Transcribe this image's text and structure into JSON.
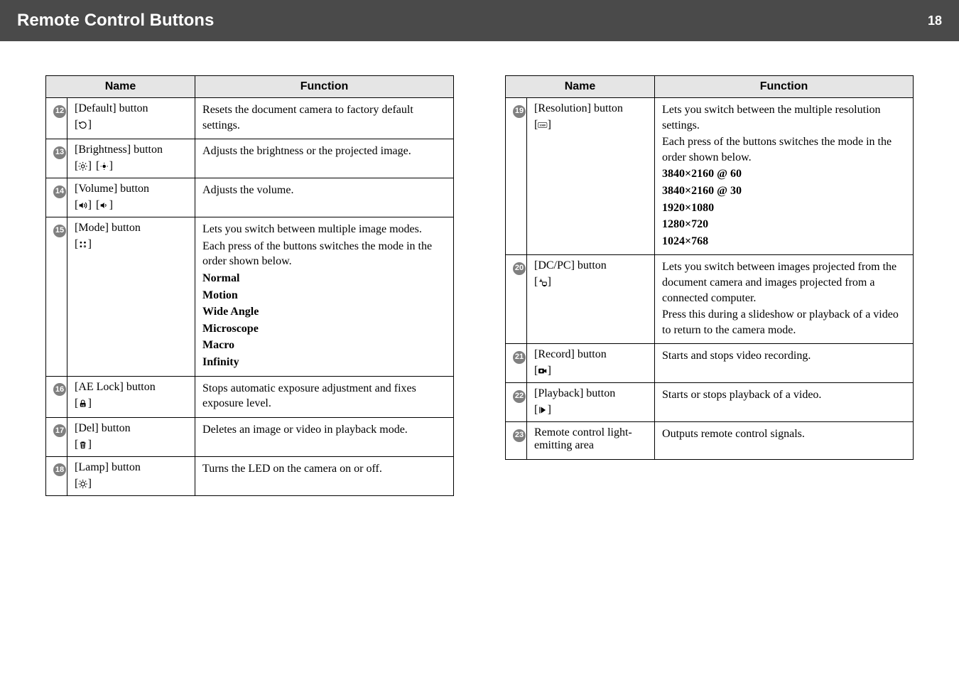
{
  "header": {
    "title": "Remote Control Buttons",
    "page": "18"
  },
  "columns": {
    "name_header": "Name",
    "function_header": "Function"
  },
  "left": [
    {
      "num": "12",
      "name": "[Default] button",
      "icon_names": [
        "default-icon"
      ],
      "func_lines": [
        {
          "t": "Resets the document camera to factory default settings."
        }
      ]
    },
    {
      "num": "13",
      "name": "[Brightness] button",
      "icon_names": [
        "brightness-up-icon",
        "brightness-down-icon"
      ],
      "func_lines": [
        {
          "t": "Adjusts the brightness or the projected image."
        }
      ]
    },
    {
      "num": "14",
      "name": "[Volume] button",
      "icon_names": [
        "volume-up-icon",
        "volume-down-icon"
      ],
      "func_lines": [
        {
          "t": "Adjusts the volume."
        }
      ]
    },
    {
      "num": "15",
      "name": "[Mode] button",
      "icon_names": [
        "mode-icon"
      ],
      "func_lines": [
        {
          "t": "Lets you switch between multiple image modes."
        },
        {
          "t": "Each press of the buttons switches the mode in the order shown below."
        },
        {
          "t": "Normal",
          "bold": true
        },
        {
          "t": "Motion",
          "bold": true
        },
        {
          "t": "Wide Angle",
          "bold": true
        },
        {
          "t": "Microscope",
          "bold": true
        },
        {
          "t": "Macro",
          "bold": true
        },
        {
          "t": "Infinity",
          "bold": true
        }
      ]
    },
    {
      "num": "16",
      "name": "[AE Lock] button",
      "icon_names": [
        "ae-lock-icon"
      ],
      "func_lines": [
        {
          "t": "Stops automatic exposure adjustment and fixes exposure level."
        }
      ]
    },
    {
      "num": "17",
      "name": "[Del] button",
      "icon_names": [
        "delete-icon"
      ],
      "func_lines": [
        {
          "t": "Deletes an image or video in playback mode."
        }
      ]
    },
    {
      "num": "18",
      "name": "[Lamp] button",
      "icon_names": [
        "lamp-icon"
      ],
      "func_lines": [
        {
          "t": "Turns the LED on the camera on or off."
        }
      ]
    }
  ],
  "right": [
    {
      "num": "19",
      "name": "[Resolution] button",
      "icon_names": [
        "resolution-1080-icon"
      ],
      "func_lines": [
        {
          "t": "Lets you switch between the multiple resolution settings."
        },
        {
          "t": "Each press of the buttons switches the mode in the order shown below."
        },
        {
          "t": "3840×2160 @ 60",
          "bold": true
        },
        {
          "t": "3840×2160 @ 30",
          "bold": true
        },
        {
          "t": "1920×1080",
          "bold": true
        },
        {
          "t": "1280×720",
          "bold": true
        },
        {
          "t": "1024×768",
          "bold": true
        }
      ]
    },
    {
      "num": "20",
      "name": "[DC/PC] button",
      "icon_names": [
        "dc-pc-icon"
      ],
      "func_lines": [
        {
          "t": "Lets you switch between images projected from the document camera and images projected from a connected computer."
        },
        {
          "t": "Press this during a slideshow or playback of a video to return to the camera mode."
        }
      ]
    },
    {
      "num": "21",
      "name": "[Record] button",
      "icon_names": [
        "record-icon"
      ],
      "func_lines": [
        {
          "t": "Starts and stops video recording."
        }
      ]
    },
    {
      "num": "22",
      "name": "[Playback] button",
      "icon_names": [
        "playback-icon"
      ],
      "func_lines": [
        {
          "t": "Starts or stops playback of a video."
        }
      ]
    },
    {
      "num": "23",
      "name": "Remote control light-emitting area",
      "icon_names": [],
      "func_lines": [
        {
          "t": "Outputs remote control signals."
        }
      ]
    }
  ]
}
